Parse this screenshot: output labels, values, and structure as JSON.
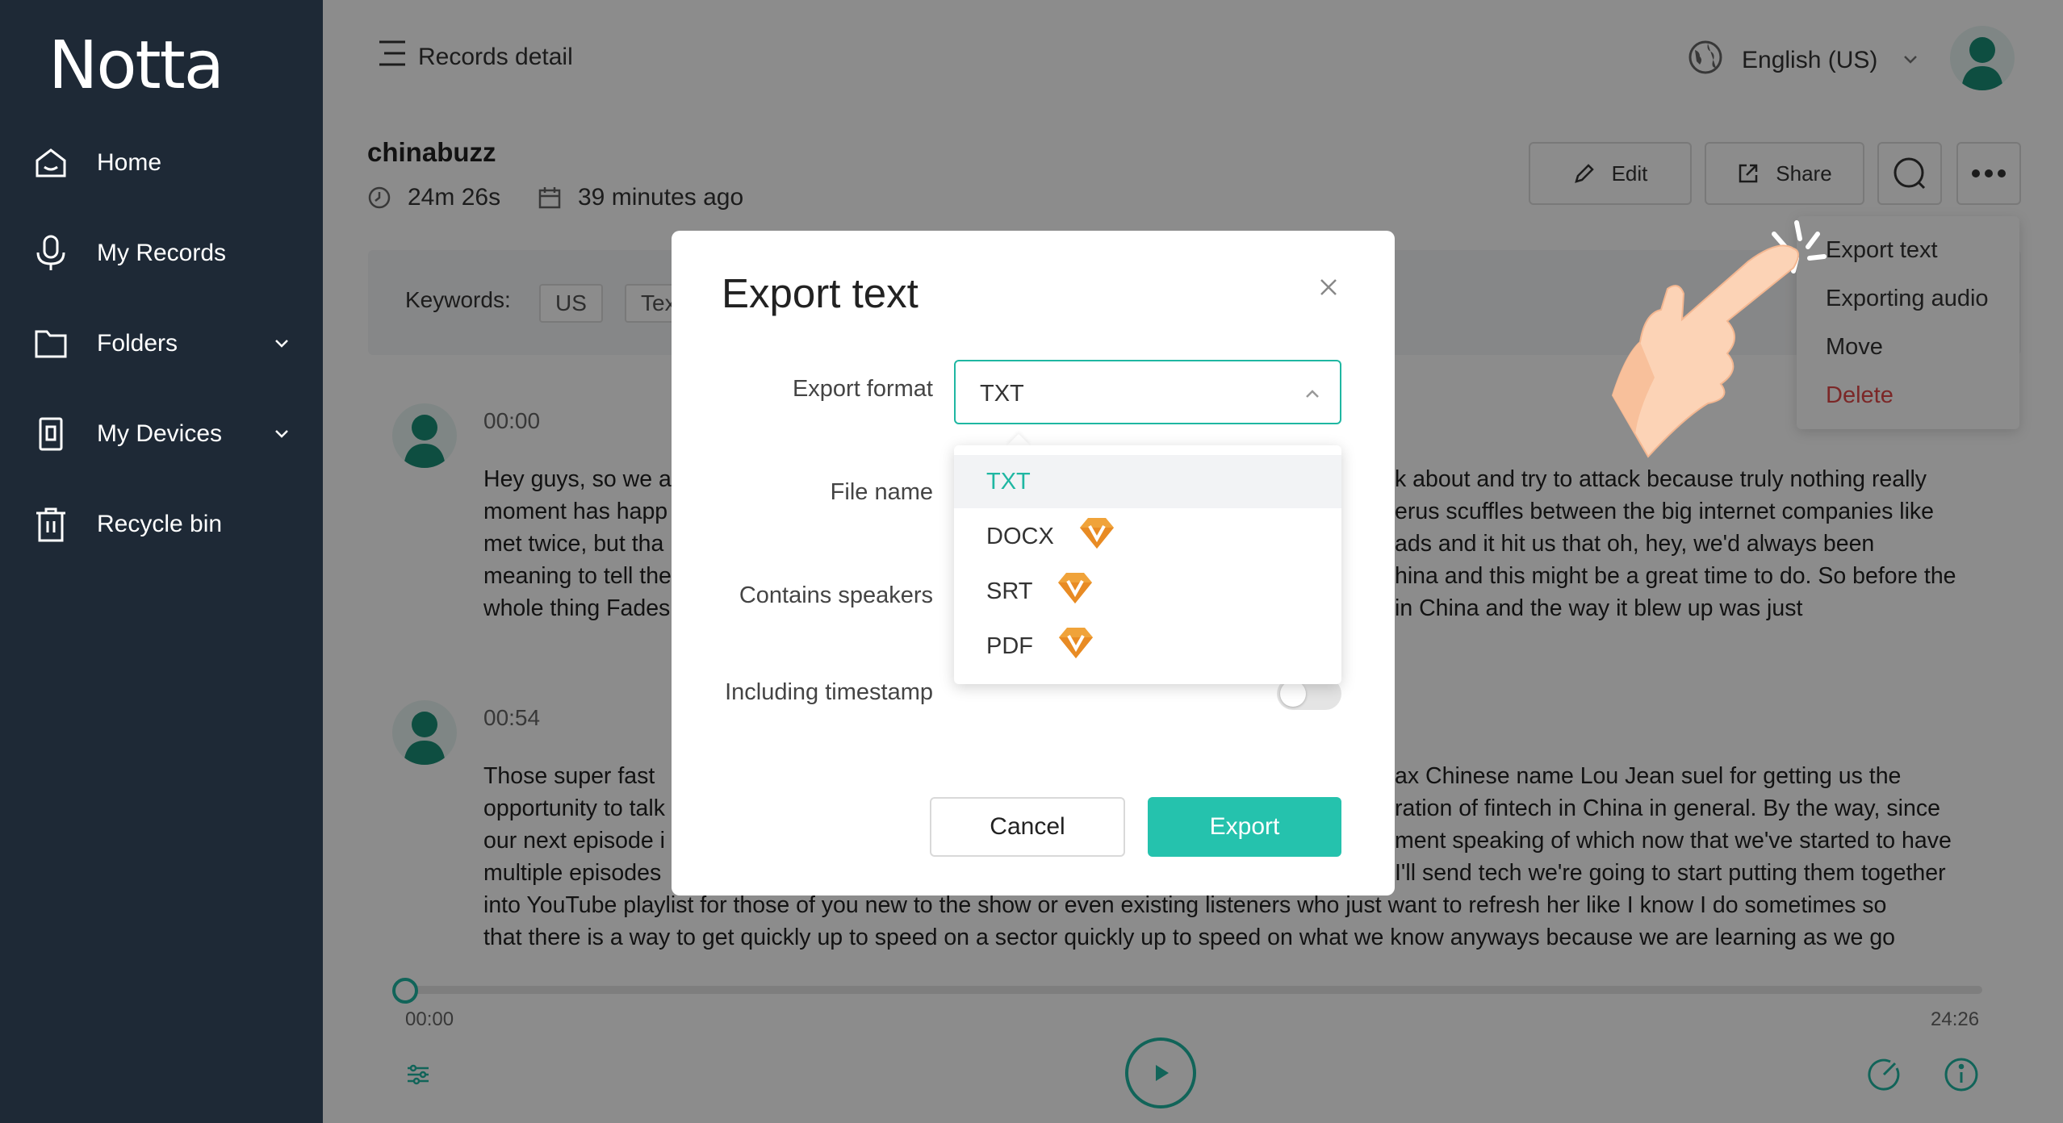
{
  "app": {
    "logo": "Notta"
  },
  "sidebar": {
    "items": [
      {
        "label": "Home",
        "icon": "home-icon"
      },
      {
        "label": "My Records",
        "icon": "microphone-icon"
      },
      {
        "label": "Folders",
        "icon": "folder-icon",
        "expandable": true
      },
      {
        "label": "My Devices",
        "icon": "device-icon",
        "expandable": true
      },
      {
        "label": "Recycle bin",
        "icon": "trash-icon"
      }
    ]
  },
  "header": {
    "breadcrumb": "Records detail",
    "language": "English (US)"
  },
  "record": {
    "title": "chinabuzz",
    "duration": "24m 26s",
    "created": "39 minutes ago",
    "edit_label": "Edit",
    "share_label": "Share"
  },
  "keywords": {
    "label": "Keywords:",
    "chips": [
      "US",
      "Tex"
    ]
  },
  "transcript": [
    {
      "time": "00:00",
      "lines": [
        "Hey guys, so we a",
        "moment has happ",
        "met twice, but tha",
        "meaning to tell the",
        "whole thing Fades"
      ],
      "lines_right": [
        "k about and try to attack because truly nothing really",
        "erus scuffles between the big internet companies like",
        "ads and it hit us that oh, hey, we'd always been",
        "hina and this might be a great time to do. So before the",
        "in China and the way it blew up was just"
      ]
    },
    {
      "time": "00:54",
      "lines": [
        "Those super fast",
        "opportunity to talk",
        "our next episode i",
        "multiple episodes",
        "into YouTube playlist for those of you new to the show or even existing listeners who just want to refresh her like I know I do sometimes so",
        "that there is a way to get quickly up to speed on a sector quickly up to speed on what we know anyways because we are learning as we go"
      ],
      "lines_right": [
        "ax Chinese name Lou Jean suel for getting us the",
        "ration of fintech in China in general. By the way, since",
        "ment speaking of which now that we've started to have",
        "I'll send tech we're going to start putting them together"
      ]
    }
  ],
  "player": {
    "current": "00:00",
    "total": "24:26",
    "progress": 0
  },
  "more_menu": {
    "items": [
      "Export text",
      "Exporting audio",
      "Move",
      "Delete"
    ]
  },
  "modal": {
    "title": "Export text",
    "format_label": "Export format",
    "format_value": "TXT",
    "file_name_label": "File name",
    "speakers_label": "Contains speakers",
    "timestamp_label": "Including timestamp",
    "timestamp_on": false,
    "options": [
      {
        "label": "TXT",
        "premium": false,
        "selected": true
      },
      {
        "label": "DOCX",
        "premium": true
      },
      {
        "label": "SRT",
        "premium": true
      },
      {
        "label": "PDF",
        "premium": true
      }
    ],
    "cancel_label": "Cancel",
    "export_label": "Export"
  },
  "colors": {
    "accent": "#25c2ad",
    "sidebar": "#1e2936",
    "danger": "#e04848",
    "premium": "#f0a33a"
  }
}
